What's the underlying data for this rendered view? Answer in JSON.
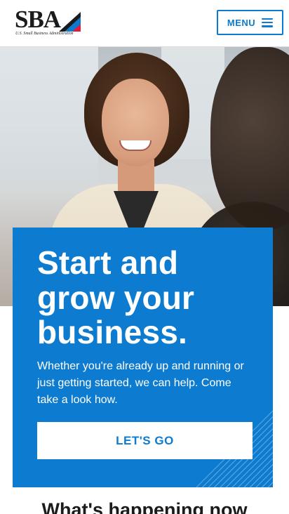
{
  "header": {
    "logo_text": "SBA",
    "logo_subtitle": "U.S. Small Business Administration",
    "menu_label": "MENU"
  },
  "hero": {
    "title": "Start and grow your business.",
    "description": "Whether you're already up and running or just getting started, we can help. Come take a look how.",
    "cta_label": "LET'S GO"
  },
  "next_section": {
    "title": "What's happening now"
  },
  "colors": {
    "brand_blue": "#0d7bcf",
    "logo_red": "#e31c3d",
    "text_dark": "#1b1b1b"
  }
}
